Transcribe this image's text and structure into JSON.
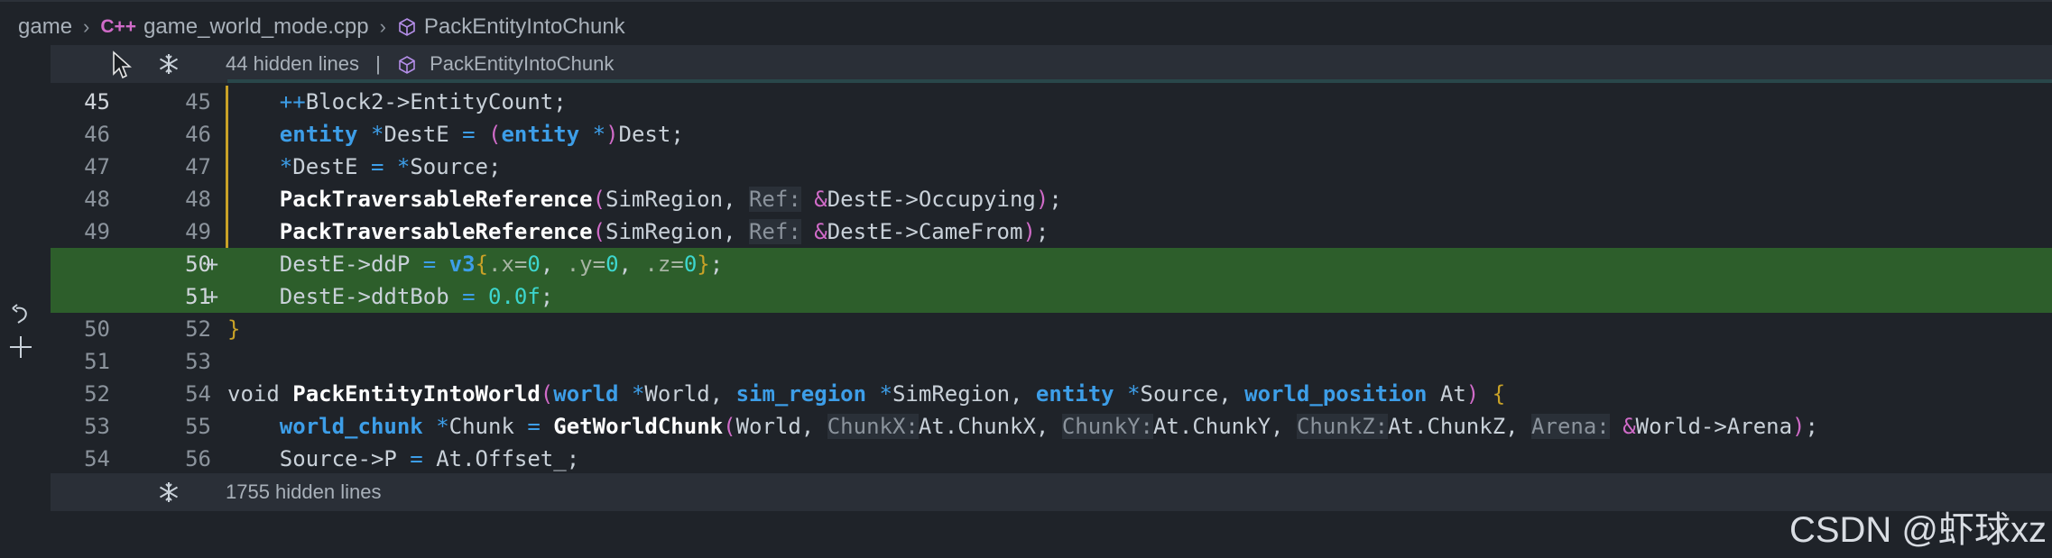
{
  "breadcrumb": {
    "items": [
      "game",
      "game_world_mode.cpp",
      "PackEntityIntoChunk"
    ],
    "cpp_badge": "C++"
  },
  "hidden_top": {
    "text": "44 hidden lines",
    "separator": "|",
    "symbol": "PackEntityIntoChunk"
  },
  "hidden_bottom": {
    "text": "1755 hidden lines"
  },
  "lines": [
    {
      "old": "45",
      "new": "45",
      "tokens": [
        [
          "op",
          "++"
        ],
        [
          "t",
          "Block2->EntityCount;"
        ]
      ]
    },
    {
      "old": "46",
      "new": "46",
      "tokens": [
        [
          "kw",
          "entity"
        ],
        [
          "t",
          " "
        ],
        [
          "op",
          "*"
        ],
        [
          "t",
          "DestE "
        ],
        [
          "op",
          "="
        ],
        [
          "t",
          " "
        ],
        [
          "paren",
          "("
        ],
        [
          "kw",
          "entity"
        ],
        [
          "t",
          " "
        ],
        [
          "op",
          "*"
        ],
        [
          "paren",
          ")"
        ],
        [
          "t",
          "Dest;"
        ]
      ]
    },
    {
      "old": "47",
      "new": "47",
      "tokens": [
        [
          "op",
          "*"
        ],
        [
          "t",
          "DestE "
        ],
        [
          "op",
          "="
        ],
        [
          "t",
          " "
        ],
        [
          "op",
          "*"
        ],
        [
          "t",
          "Source;"
        ]
      ]
    },
    {
      "old": "48",
      "new": "48",
      "tokens": [
        [
          "fn",
          "PackTraversableReference"
        ],
        [
          "paren",
          "("
        ],
        [
          "t",
          "SimRegion, "
        ],
        [
          "hint",
          "Ref:"
        ],
        [
          "t",
          " "
        ],
        [
          "amp",
          "&"
        ],
        [
          "t",
          "DestE->Occupying"
        ],
        [
          "paren",
          ")"
        ],
        [
          "t",
          ";"
        ]
      ]
    },
    {
      "old": "49",
      "new": "49",
      "tokens": [
        [
          "fn",
          "PackTraversableReference"
        ],
        [
          "paren",
          "("
        ],
        [
          "t",
          "SimRegion, "
        ],
        [
          "hint",
          "Ref:"
        ],
        [
          "t",
          " "
        ],
        [
          "amp",
          "&"
        ],
        [
          "t",
          "DestE->CameFrom"
        ],
        [
          "paren",
          ")"
        ],
        [
          "t",
          ";"
        ]
      ]
    },
    {
      "old": "",
      "new": "50",
      "marker": "+",
      "added": true,
      "tokens": [
        [
          "t",
          "DestE->ddP "
        ],
        [
          "op",
          "="
        ],
        [
          "t",
          " "
        ],
        [
          "kw",
          "v3"
        ],
        [
          "brace",
          "{"
        ],
        [
          "hintg",
          ".x="
        ],
        [
          "num",
          "0"
        ],
        [
          "t",
          ", "
        ],
        [
          "hintg",
          ".y="
        ],
        [
          "num",
          "0"
        ],
        [
          "t",
          ", "
        ],
        [
          "hintg",
          ".z="
        ],
        [
          "num",
          "0"
        ],
        [
          "brace",
          "}"
        ],
        [
          "t",
          ";"
        ]
      ]
    },
    {
      "old": "",
      "new": "51",
      "marker": "+",
      "added": true,
      "tokens": [
        [
          "t",
          "DestE->ddtBob "
        ],
        [
          "op",
          "="
        ],
        [
          "t",
          " "
        ],
        [
          "num",
          "0.0f"
        ],
        [
          "t",
          ";"
        ]
      ]
    },
    {
      "old": "50",
      "new": "52",
      "tokens": [
        [
          "brace",
          "}"
        ]
      ],
      "indent": 0
    },
    {
      "old": "51",
      "new": "53",
      "tokens": [],
      "indent": 0
    },
    {
      "old": "52",
      "new": "54",
      "indent": 0,
      "tokens": [
        [
          "kwn",
          "void"
        ],
        [
          "t",
          " "
        ],
        [
          "fn",
          "PackEntityIntoWorld"
        ],
        [
          "paren",
          "("
        ],
        [
          "kw",
          "world"
        ],
        [
          "t",
          " "
        ],
        [
          "op",
          "*"
        ],
        [
          "t",
          "World, "
        ],
        [
          "kw",
          "sim_region"
        ],
        [
          "t",
          " "
        ],
        [
          "op",
          "*"
        ],
        [
          "t",
          "SimRegion, "
        ],
        [
          "kw",
          "entity"
        ],
        [
          "t",
          " "
        ],
        [
          "op",
          "*"
        ],
        [
          "t",
          "Source, "
        ],
        [
          "kw",
          "world_position"
        ],
        [
          "t",
          " At"
        ],
        [
          "paren",
          ")"
        ],
        [
          "t",
          " "
        ],
        [
          "brace",
          "{"
        ]
      ]
    },
    {
      "old": "53",
      "new": "55",
      "tokens": [
        [
          "kw",
          "world_chunk"
        ],
        [
          "t",
          " "
        ],
        [
          "op",
          "*"
        ],
        [
          "t",
          "Chunk "
        ],
        [
          "op",
          "="
        ],
        [
          "t",
          " "
        ],
        [
          "fn",
          "GetWorldChunk"
        ],
        [
          "paren",
          "("
        ],
        [
          "t",
          "World, "
        ],
        [
          "hint",
          "ChunkX:"
        ],
        [
          "t",
          "At.ChunkX, "
        ],
        [
          "hint",
          "ChunkY:"
        ],
        [
          "t",
          "At.ChunkY, "
        ],
        [
          "hint",
          "ChunkZ:"
        ],
        [
          "t",
          "At.ChunkZ, "
        ],
        [
          "hint",
          "Arena:"
        ],
        [
          "t",
          " "
        ],
        [
          "amp",
          "&"
        ],
        [
          "t",
          "World->Arena"
        ],
        [
          "paren",
          ")"
        ],
        [
          "t",
          ";"
        ]
      ]
    },
    {
      "old": "54",
      "new": "56",
      "tokens": [
        [
          "t",
          "Source->P "
        ],
        [
          "op",
          "="
        ],
        [
          "t",
          " At.Offset_;"
        ]
      ]
    }
  ],
  "watermark": "CSDN @虾球xz"
}
